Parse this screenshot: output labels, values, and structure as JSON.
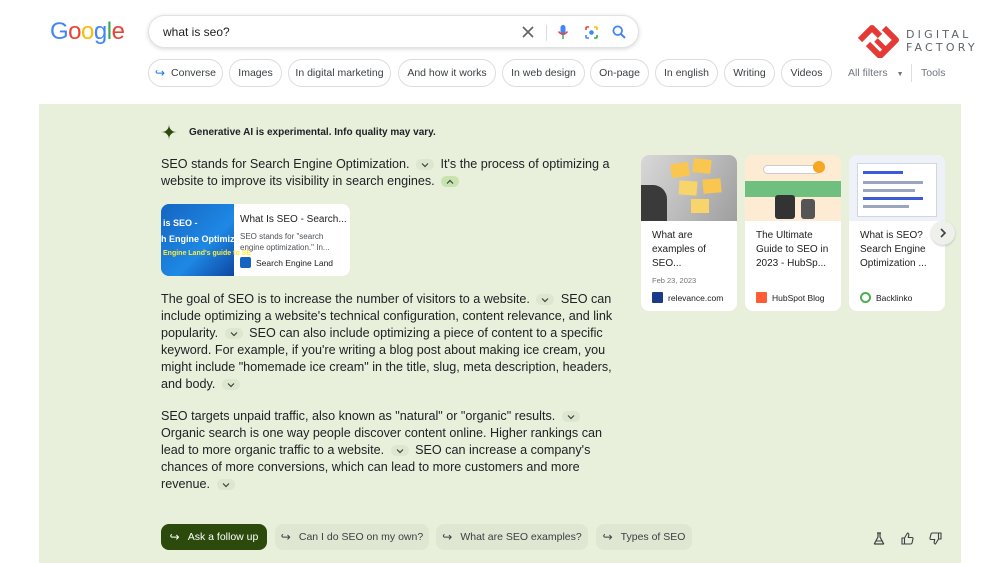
{
  "header": {
    "logo": "Google",
    "search_query": "what is seo?",
    "brand": {
      "line1": "DIGITAL",
      "line2": "FACTORY"
    }
  },
  "chips": [
    {
      "label": "Converse",
      "icon": "follow-arrow-icon"
    },
    {
      "label": "Images"
    },
    {
      "label": "In digital marketing"
    },
    {
      "label": "And how it works"
    },
    {
      "label": "In web design"
    },
    {
      "label": "On-page"
    },
    {
      "label": "In english"
    },
    {
      "label": "Writing"
    },
    {
      "label": "Videos"
    }
  ],
  "filters": {
    "all_filters": "All filters",
    "tools": "Tools"
  },
  "ai": {
    "notice": "Generative AI is experimental. Info quality may vary.",
    "p1": {
      "s1": "SEO stands for Search Engine Optimization.",
      "s2": "It's the process of optimizing a website to improve its visibility in search engines."
    },
    "source": {
      "title": "What Is SEO - Search...",
      "snippet": "SEO stands for \"search engine optimization.\" In...",
      "site": "Search Engine Land",
      "thumb_line1": "is SEO -",
      "thumb_line2": "h Engine Optimizati",
      "thumb_line3": "Engine Land's guide to SE"
    },
    "p2": {
      "s1": "The goal of SEO is to increase the number of visitors to a website.",
      "s2": "SEO can include optimizing a website's technical configuration, content relevance, and link popularity.",
      "s3": "SEO can also include optimizing a piece of content to a specific keyword. For example, if you're writing a blog post about making ice cream, you might include \"homemade ice cream\" in the title, slug, meta description, headers, and body."
    },
    "p3": {
      "s1": "SEO targets unpaid traffic, also known as \"natural\" or \"organic\" results.",
      "s2": "Organic search is one way people discover content online. Higher rankings can lead to more organic traffic to a website.",
      "s3": "SEO can increase a company's chances of more conversions, which can lead to more customers and more revenue."
    },
    "cards": [
      {
        "title": "What are examples of SEO...",
        "date": "Feb 23, 2023",
        "site": "relevance.com"
      },
      {
        "title": "The Ultimate Guide to SEO in 2023 - HubSp...",
        "date": "",
        "site": "HubSpot Blog"
      },
      {
        "title": "What is SEO? Search Engine Optimization ...",
        "date": "",
        "site": "Backlinko"
      }
    ],
    "followups": {
      "primary": "Ask a follow up",
      "q1": "Can I do SEO on my own?",
      "q2": "What are SEO examples?",
      "q3": "Types of SEO"
    }
  }
}
